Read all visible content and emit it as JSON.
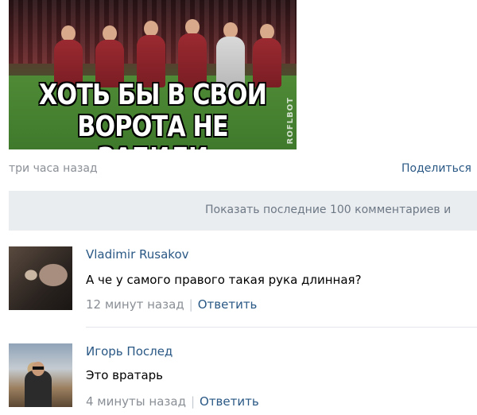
{
  "post": {
    "image": {
      "meme_line1": "ХОТЬ БЫ В СВОИ",
      "meme_line2": "ВОРОТА НЕ ЗАБИЛИ",
      "watermark": "ROFLBOT"
    },
    "time": "три часа назад",
    "share_label": "Поделиться"
  },
  "show_more_label": "Показать последние 100 комментариев и",
  "comments": [
    {
      "author": "Vladimir Rusakov",
      "text": "А че у самого правого такая рука длинная?",
      "time": "12 минут назад",
      "reply_label": "Ответить"
    },
    {
      "author": "Игорь Послед",
      "text": "Это вратарь",
      "time": "4 минуты назад",
      "reply_label": "Ответить"
    }
  ],
  "colors": {
    "link": "#2a5885",
    "muted": "#8a8f96",
    "bar_bg": "#eaedf0"
  }
}
